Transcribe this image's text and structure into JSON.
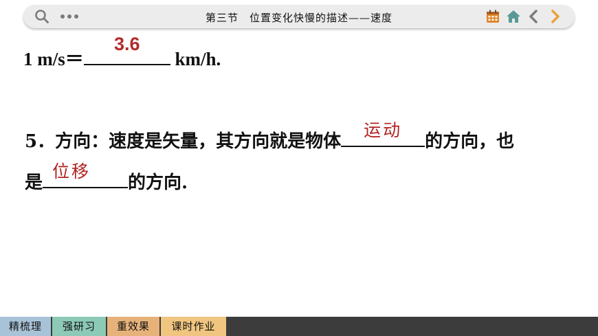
{
  "header": {
    "title": "第三节　位置变化快慢的描述——速度",
    "icons": [
      "search-icon",
      "more-dots-icon",
      "calendar-icon",
      "home-icon",
      "back-arrow-icon",
      "forward-arrow-icon"
    ],
    "colors": {
      "bar_bg": "#ececec",
      "icon_gray": "#7a7a7a",
      "calendar_orange": "#e0862a",
      "home_teal": "#5a9a96",
      "back_gray": "#7d7d7d",
      "forward_orange": "#e9a23b"
    }
  },
  "content": {
    "line1": {
      "prefix": "1 m/s＝",
      "answer": "3.6",
      "suffix": " km/h."
    },
    "line2": {
      "prefix": "5．方向：速度是矢量，其方向就是物体",
      "answer": "运动",
      "suffix": "的方向，也"
    },
    "line3": {
      "prefix": "是",
      "answer": "位移",
      "suffix": "的方向."
    },
    "answer_color": "#b22222"
  },
  "tabs": [
    {
      "label": "精梳理",
      "color": "#a8c3d8"
    },
    {
      "label": "强研习",
      "color": "#8cc9b6"
    },
    {
      "label": "重效果",
      "color": "#e7b27a"
    },
    {
      "label": "课时作业",
      "color": "#f0c57f"
    }
  ]
}
